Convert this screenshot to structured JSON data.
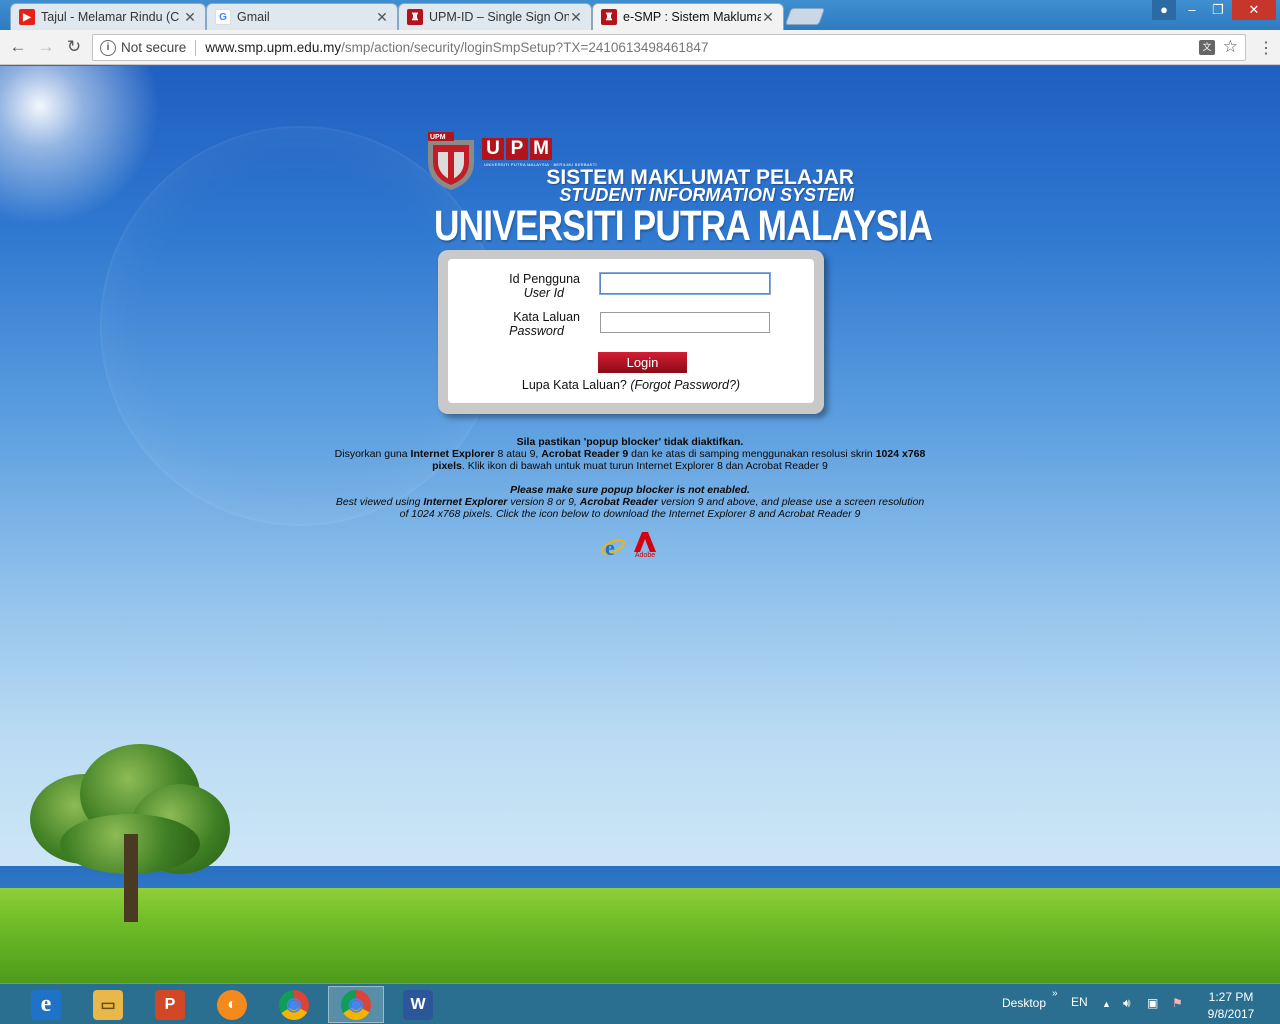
{
  "browser": {
    "tabs": [
      {
        "title": "Tajul - Melamar Rindu (C",
        "favicon": "youtube-icon"
      },
      {
        "title": "Gmail",
        "favicon": "google-icon"
      },
      {
        "title": "UPM-ID – Single Sign On",
        "favicon": "upm-icon"
      },
      {
        "title": "e-SMP : Sistem Maklumat",
        "favicon": "upm-icon"
      }
    ],
    "active_tab": 3,
    "tab_close_glyph": "✕",
    "security_label": "Not secure",
    "url_host": "www.smp.upm.edu.my",
    "url_path": "/smp/action/security/loginSmpSetup?TX=2410613498461847"
  },
  "header": {
    "upm_letters": [
      "U",
      "P",
      "M"
    ],
    "crest_label": "UPM",
    "tagline": "UNIVERSITI PUTRA MALAYSIA · BERILMU BERBAKTI",
    "system_name_my": "SISTEM MAKLUMAT PELAJAR",
    "system_name_en": "STUDENT INFORMATION SYSTEM",
    "university_name": "UNIVERSITI PUTRA MALAYSIA"
  },
  "login": {
    "user_label": "Id Pengguna",
    "user_label_en": "User Id",
    "user_value": "",
    "pass_label": "Kata Laluan",
    "pass_label_en": "Password",
    "pass_value": "",
    "button_label": "Login",
    "forgot_my": "Lupa Kata Laluan? ",
    "forgot_en": "(Forgot Password?)"
  },
  "notice": {
    "my_line1": "Sila pastikan 'popup blocker' tidak diaktifkan.",
    "my_line2_a": "Disyorkan guna ",
    "my_line2_b": "Internet Explorer",
    "my_line2_c": " 8 atau 9, ",
    "my_line2_d": "Acrobat Reader 9",
    "my_line2_e": " dan ke atas di samping menggunakan resolusi skrin ",
    "my_line2_f": "1024 x768 pixels",
    "my_line2_g": ". Klik ikon di bawah untuk muat turun Internet Explorer 8 dan Acrobat Reader 9",
    "en_line1": "Please make sure popup blocker is not enabled.",
    "en_line2_a": "Best viewed using ",
    "en_line2_b": "Internet Explorer",
    "en_line2_c": " version 8 or 9, ",
    "en_line2_d": "Acrobat Reader",
    "en_line2_e": " version 9 and above, and please use a screen resolution of 1024 x768 pixels. Click the icon below to download the Internet Explorer 8 and Acrobat Reader 9",
    "adobe_label": "Adobe"
  },
  "taskbar": {
    "apps": [
      {
        "name": "internet-explorer-icon",
        "glyph": "e",
        "color": "#1e73c8"
      },
      {
        "name": "file-explorer-icon",
        "glyph": "▭",
        "color": "#e8b94a"
      },
      {
        "name": "powerpoint-icon",
        "glyph": "P",
        "color": "#d24726"
      },
      {
        "name": "media-app-icon",
        "glyph": "◐",
        "color": "#f28a1e"
      },
      {
        "name": "chrome-icon",
        "glyph": "◉",
        "color": "#2f9e44"
      },
      {
        "name": "chrome-icon",
        "glyph": "◉",
        "color": "#2f9e44"
      },
      {
        "name": "word-icon",
        "glyph": "W",
        "color": "#2b579a"
      }
    ],
    "active_app": 5,
    "desktop_label": "Desktop",
    "chevron": "»",
    "language": "EN",
    "time": "1:27 PM",
    "date": "9/8/2017"
  }
}
